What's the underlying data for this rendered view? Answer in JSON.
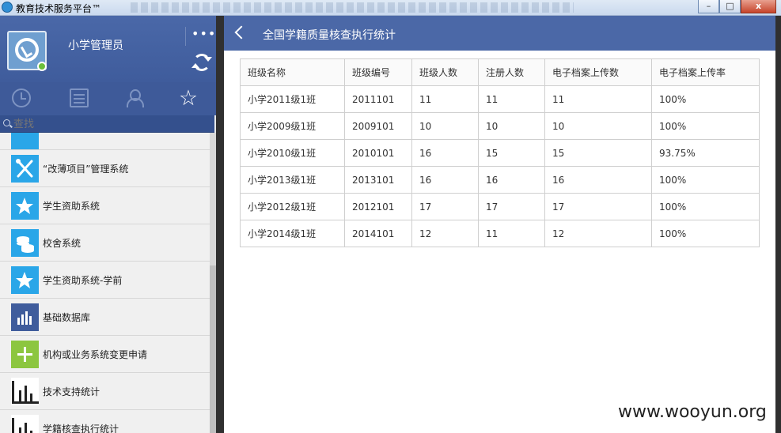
{
  "window": {
    "title": "教育技术服务平台™",
    "minimize": "–",
    "maximize": "□",
    "close": "x"
  },
  "profile": {
    "username": "小学管理员",
    "more_label": "•••"
  },
  "tabs": {
    "favorites_glyph": "☆"
  },
  "search": {
    "placeholder": "查找"
  },
  "apps": [
    {
      "label": "",
      "icon": "database-icon",
      "color": "#2aa6e8"
    },
    {
      "label": "“改薄项目”管理系统",
      "icon": "tools-icon",
      "color": "#2aa6e8"
    },
    {
      "label": "学生资助系统",
      "icon": "star-icon",
      "color": "#2aa6e8"
    },
    {
      "label": "校舍系统",
      "icon": "coins-icon",
      "color": "#2aa6e8"
    },
    {
      "label": "学生资助系统-学前",
      "icon": "star-icon",
      "color": "#2aa6e8"
    },
    {
      "label": "基础数据库",
      "icon": "bar-chart-icon",
      "color": "#3f5c9c"
    },
    {
      "label": "机构或业务系统变更申请",
      "icon": "plus-icon",
      "color": "#8cc63f"
    },
    {
      "label": "技术支持统计",
      "icon": "bar-chart-icon",
      "color": "#ffffff"
    },
    {
      "label": "学籍核查执行统计",
      "icon": "bar-chart-icon",
      "color": "#ffffff"
    }
  ],
  "main": {
    "title": "全国学籍质量核查执行统计",
    "columns": [
      "班级名称",
      "班级编号",
      "班级人数",
      "注册人数",
      "电子档案上传数",
      "电子档案上传率"
    ],
    "rows": [
      [
        "小学2011级1班",
        "2011101",
        "11",
        "11",
        "11",
        "100%"
      ],
      [
        "小学2009级1班",
        "2009101",
        "10",
        "10",
        "10",
        "100%"
      ],
      [
        "小学2010级1班",
        "2010101",
        "16",
        "15",
        "15",
        "93.75%"
      ],
      [
        "小学2013级1班",
        "2013101",
        "16",
        "16",
        "16",
        "100%"
      ],
      [
        "小学2012级1班",
        "2012101",
        "17",
        "17",
        "17",
        "100%"
      ],
      [
        "小学2014级1班",
        "2014101",
        "12",
        "11",
        "12",
        "100%"
      ]
    ]
  },
  "watermark": "www.wooyun.org",
  "colors": {
    "header_blue": "#4b68a7",
    "sidebar_blue": "#3f5c9c",
    "tile_blue": "#2aa6e8",
    "tile_green": "#8cc63f"
  }
}
